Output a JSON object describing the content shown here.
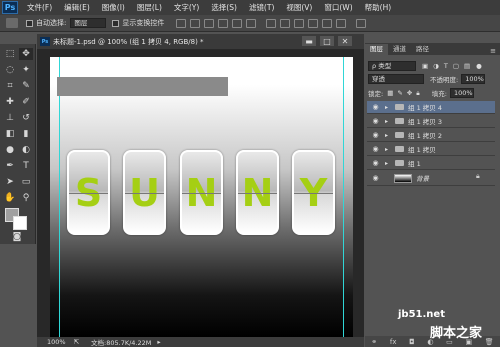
{
  "app": {
    "logo": "Ps",
    "menu": [
      "文件(F)",
      "编辑(E)",
      "图像(I)",
      "图层(L)",
      "文字(Y)",
      "选择(S)",
      "滤镜(T)",
      "视图(V)",
      "窗口(W)",
      "帮助(H)"
    ]
  },
  "options": {
    "auto_select_label": "自动选择:",
    "auto_select_value": "图层",
    "show_transform_label": "显示变换控件"
  },
  "document": {
    "tab_title": "未标题-1.psd @ 100% (组 1 拷贝 4, RGB/8) *",
    "mini_logo": "Ps",
    "min_btn": "▬",
    "max_btn": "□",
    "close_btn": "✕",
    "letters": [
      "S",
      "U",
      "N",
      "N",
      "Y"
    ],
    "letter_color": "#a5cf14",
    "zoom": "100%",
    "doc_info": "文档:805.7K/4.22M"
  },
  "panel": {
    "tabs": [
      "图层",
      "通道",
      "路径"
    ],
    "filter_label": "ρ 类型",
    "blend_mode": "穿透",
    "opacity_label": "不透明度:",
    "opacity_value": "100%",
    "lock_label": "锁定:",
    "fill_label": "填充:",
    "fill_value": "100%",
    "layers": [
      {
        "name": "组 1 拷贝 4",
        "selected": true
      },
      {
        "name": "组 1 拷贝 3"
      },
      {
        "name": "组 1 拷贝 2"
      },
      {
        "name": "组 1 拷贝"
      },
      {
        "name": "组 1"
      },
      {
        "name": "背景"
      }
    ]
  },
  "watermark": {
    "line1": "jb51.net",
    "line2": "脚本之家"
  }
}
